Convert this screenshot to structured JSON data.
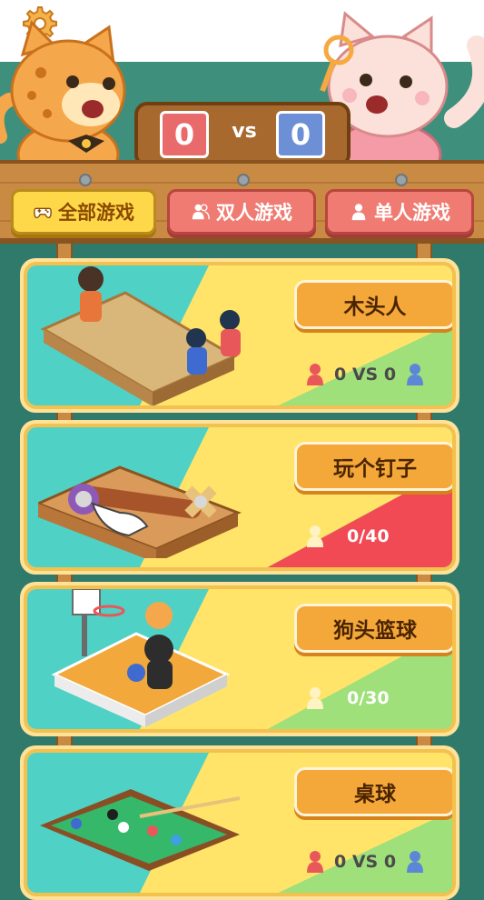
{
  "header": {
    "score_left": "0",
    "vs_label": "vs",
    "score_right": "0"
  },
  "tabs": [
    {
      "label": "全部游戏",
      "active": true
    },
    {
      "label": "双人游戏",
      "active": false
    },
    {
      "label": "单人游戏",
      "active": false
    }
  ],
  "games": [
    {
      "title": "木头人",
      "record": "0 VS 0",
      "mode": "duo"
    },
    {
      "title": "玩个钉子",
      "record": "0/40",
      "mode": "solo"
    },
    {
      "title": "狗头篮球",
      "record": "0/30",
      "mode": "solo"
    },
    {
      "title": "桌球",
      "record": "0 VS 0",
      "mode": "duo"
    }
  ],
  "colors": {
    "teal": "#3f8f7d",
    "wood": "#c98a44",
    "tab_active": "#ffd84a",
    "tab_inactive": "#f07b72",
    "title_button": "#f4a83a",
    "player_red": "#e8585a",
    "player_blue": "#5c86d6",
    "pawn_cream": "#fff3c4"
  },
  "icons": [
    "gear-icon",
    "gamepad-icon",
    "two-person-icon",
    "single-person-icon",
    "player-pawn-icon"
  ]
}
